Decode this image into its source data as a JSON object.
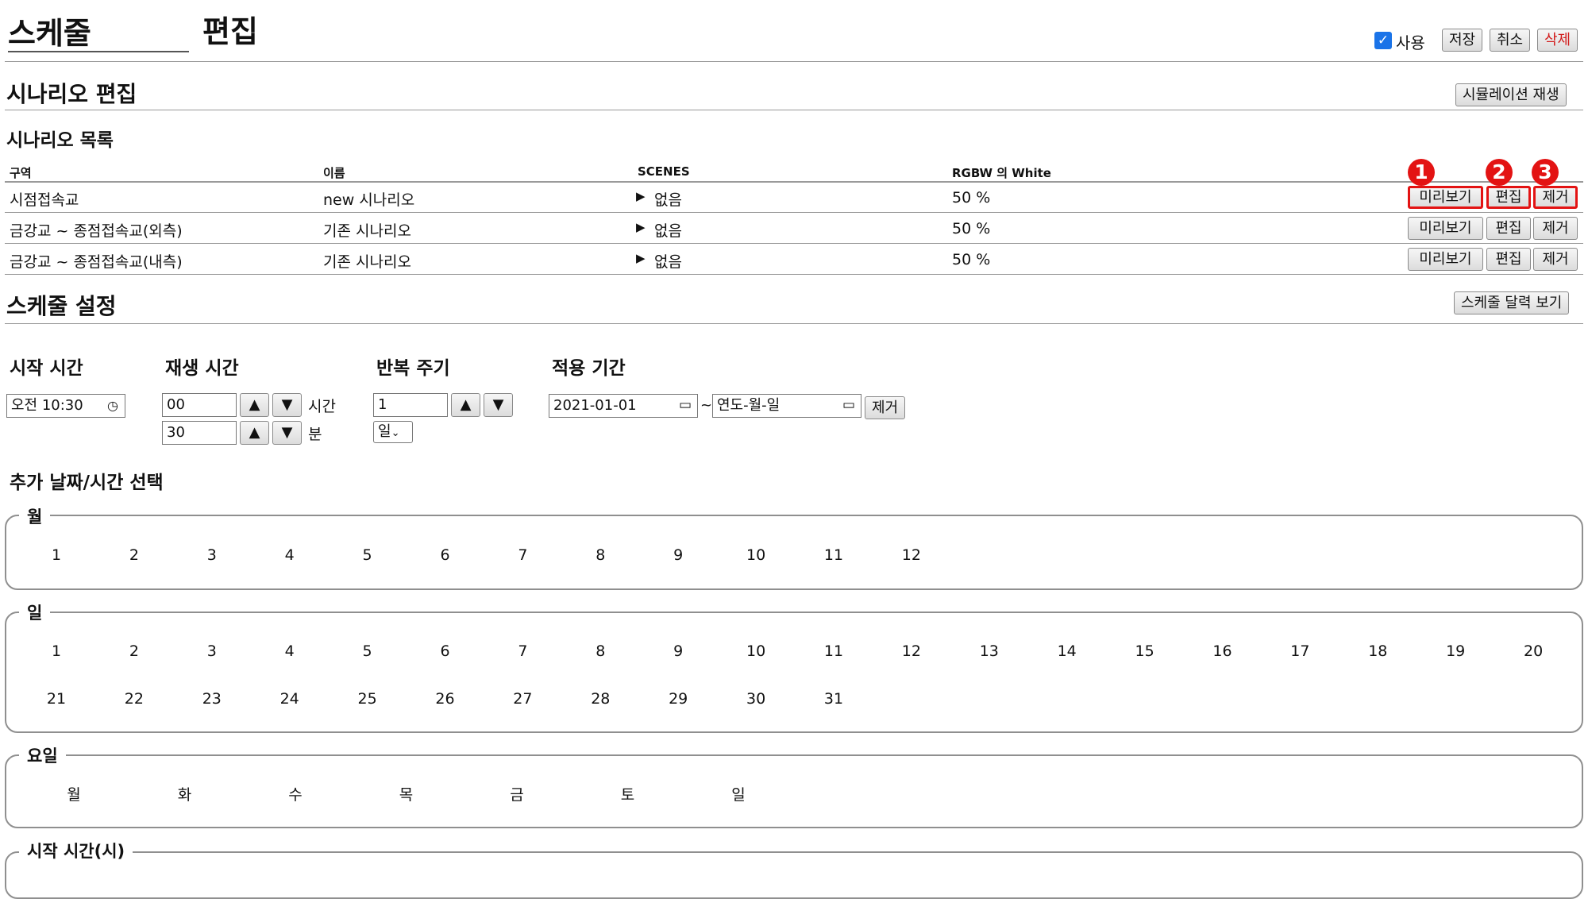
{
  "header": {
    "title": "스케줄",
    "subtitle": "편집",
    "use_label": "사용",
    "save_label": "저장",
    "cancel_label": "취소",
    "delete_label": "삭제"
  },
  "scenario_edit": {
    "heading": "시나리오 편집",
    "simulation_label": "시뮬레이션 재생",
    "list_heading": "시나리오 목록",
    "columns": [
      "구역",
      "이름",
      "SCENES",
      "RGBW 의 White"
    ],
    "rows": [
      {
        "zone": "시점접속교",
        "name": "new 시나리오",
        "scenes": "없음",
        "white": "50 %"
      },
      {
        "zone": "금강교 ~ 종점접속교(외측)",
        "name": "기존 시나리오",
        "scenes": "없음",
        "white": "50 %"
      },
      {
        "zone": "금강교 ~ 종점접속교(내측)",
        "name": "기존 시나리오",
        "scenes": "없음",
        "white": "50 %"
      }
    ],
    "row_actions": {
      "preview": "미리보기",
      "edit": "편집",
      "remove": "제거"
    },
    "badges": [
      "1",
      "2",
      "3"
    ]
  },
  "schedule": {
    "heading": "스케줄 설정",
    "calendar_label": "스케줄 달력 보기",
    "start_time_label": "시작 시간",
    "start_time_value": "오전 10:30",
    "play_time_label": "재생 시간",
    "hours_value": "00",
    "hours_unit": "시간",
    "minutes_value": "30",
    "minutes_unit": "분",
    "repeat_label": "반복 주기",
    "repeat_value": "1",
    "repeat_unit": "일",
    "period_label": "적용 기간",
    "period_start": "2021-01-01",
    "period_tilde": "~",
    "period_end_placeholder": "연도-월-일",
    "period_remove_label": "제거",
    "extra_heading": "추가 날짜/시간 선택",
    "month_legend": "월",
    "months": [
      "1",
      "2",
      "3",
      "4",
      "5",
      "6",
      "7",
      "8",
      "9",
      "10",
      "11",
      "12"
    ],
    "day_legend": "일",
    "days_row1": [
      "1",
      "2",
      "3",
      "4",
      "5",
      "6",
      "7",
      "8",
      "9",
      "10",
      "11",
      "12",
      "13",
      "14",
      "15",
      "16",
      "17",
      "18",
      "19",
      "20"
    ],
    "days_row2": [
      "21",
      "22",
      "23",
      "24",
      "25",
      "26",
      "27",
      "28",
      "29",
      "30",
      "31"
    ],
    "weekday_legend": "요일",
    "weekdays": [
      "월",
      "화",
      "수",
      "목",
      "금",
      "토",
      "일"
    ],
    "start_hour_legend": "시작 시간(시)"
  },
  "colors": {
    "accent_red": "#e31313",
    "checkbox_blue": "#1a73e8",
    "border_gray": "#999999"
  },
  "icons": [
    "clock-icon",
    "calendar-icon",
    "up-arrow-icon",
    "down-arrow-icon",
    "play-triangle-icon",
    "dropdown-chevron-icon"
  ]
}
